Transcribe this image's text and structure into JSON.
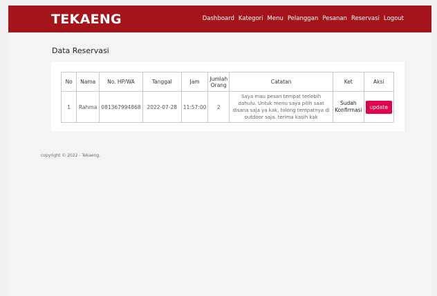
{
  "brand": "TEKAENG",
  "nav": [
    {
      "label": "Dashboard"
    },
    {
      "label": "Kategori"
    },
    {
      "label": "Menu"
    },
    {
      "label": "Pelanggan"
    },
    {
      "label": "Pesanan"
    },
    {
      "label": "Reservasi"
    },
    {
      "label": "Logout"
    }
  ],
  "page_title": "Data Reservasi",
  "table": {
    "headers": [
      "No",
      "Nama",
      "No. HP/WA",
      "Tanggal",
      "Jam",
      "Jumlah Orang",
      "Catatan",
      "Ket",
      "Aksi"
    ],
    "rows": [
      {
        "no": "1",
        "nama": "Rahma",
        "hp": "081367994868",
        "tanggal": "2022-07-28",
        "jam": "11:57:00",
        "jumlah": "2",
        "catatan": "Saya mau pesan tempat terlebih dahulu. Untuk menu saya pilih saat disana saja ya kak, tolong tempatnya di outdoor saja. terima kasih kak",
        "ket": "Sudah Konfirmasi",
        "aksi": "update"
      }
    ]
  },
  "footer": "copyright © 2022 - Tekaeng.",
  "colors": {
    "navbar": "#a4151b",
    "button": "#e0004d"
  }
}
